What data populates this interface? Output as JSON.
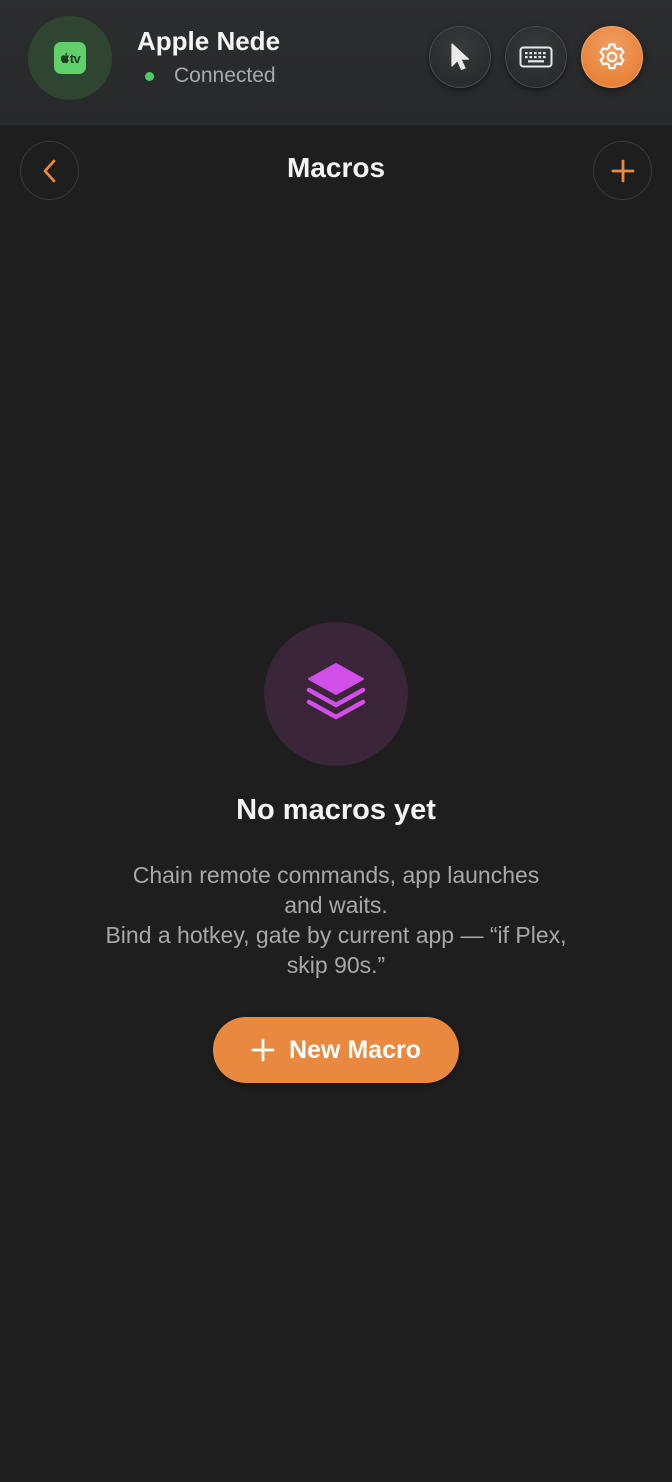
{
  "header": {
    "device_icon": {
      "name": "apple-tv-icon",
      "label": "tv",
      "color": "#5fd06a"
    },
    "device_name": "Apple Nede",
    "status": {
      "text": "Connected",
      "color": "#4ccf62"
    },
    "buttons": [
      {
        "name": "pointer-button",
        "icon": "cursor-arrow-icon"
      },
      {
        "name": "keyboard-button",
        "icon": "keyboard-icon"
      },
      {
        "name": "settings-button",
        "icon": "gear-icon",
        "active": true
      }
    ]
  },
  "nav": {
    "back_icon": "chevron-left-icon",
    "title": "Macros",
    "add_icon": "plus-icon"
  },
  "empty_state": {
    "icon": "stack-layers-icon",
    "title": "No macros yet",
    "description_lines": [
      "Chain remote commands, app launches",
      "and waits.",
      "Bind a hotkey, gate by current app — “if Plex,",
      "skip 90s.”"
    ],
    "button_label": "New Macro",
    "button_icon": "plus-icon"
  },
  "colors": {
    "accent": "#e8893f",
    "background": "#1e1e1e",
    "header_background": "#2a2b2d",
    "empty_icon_background": "#3a2539",
    "empty_icon_color": "#d24ee8"
  }
}
